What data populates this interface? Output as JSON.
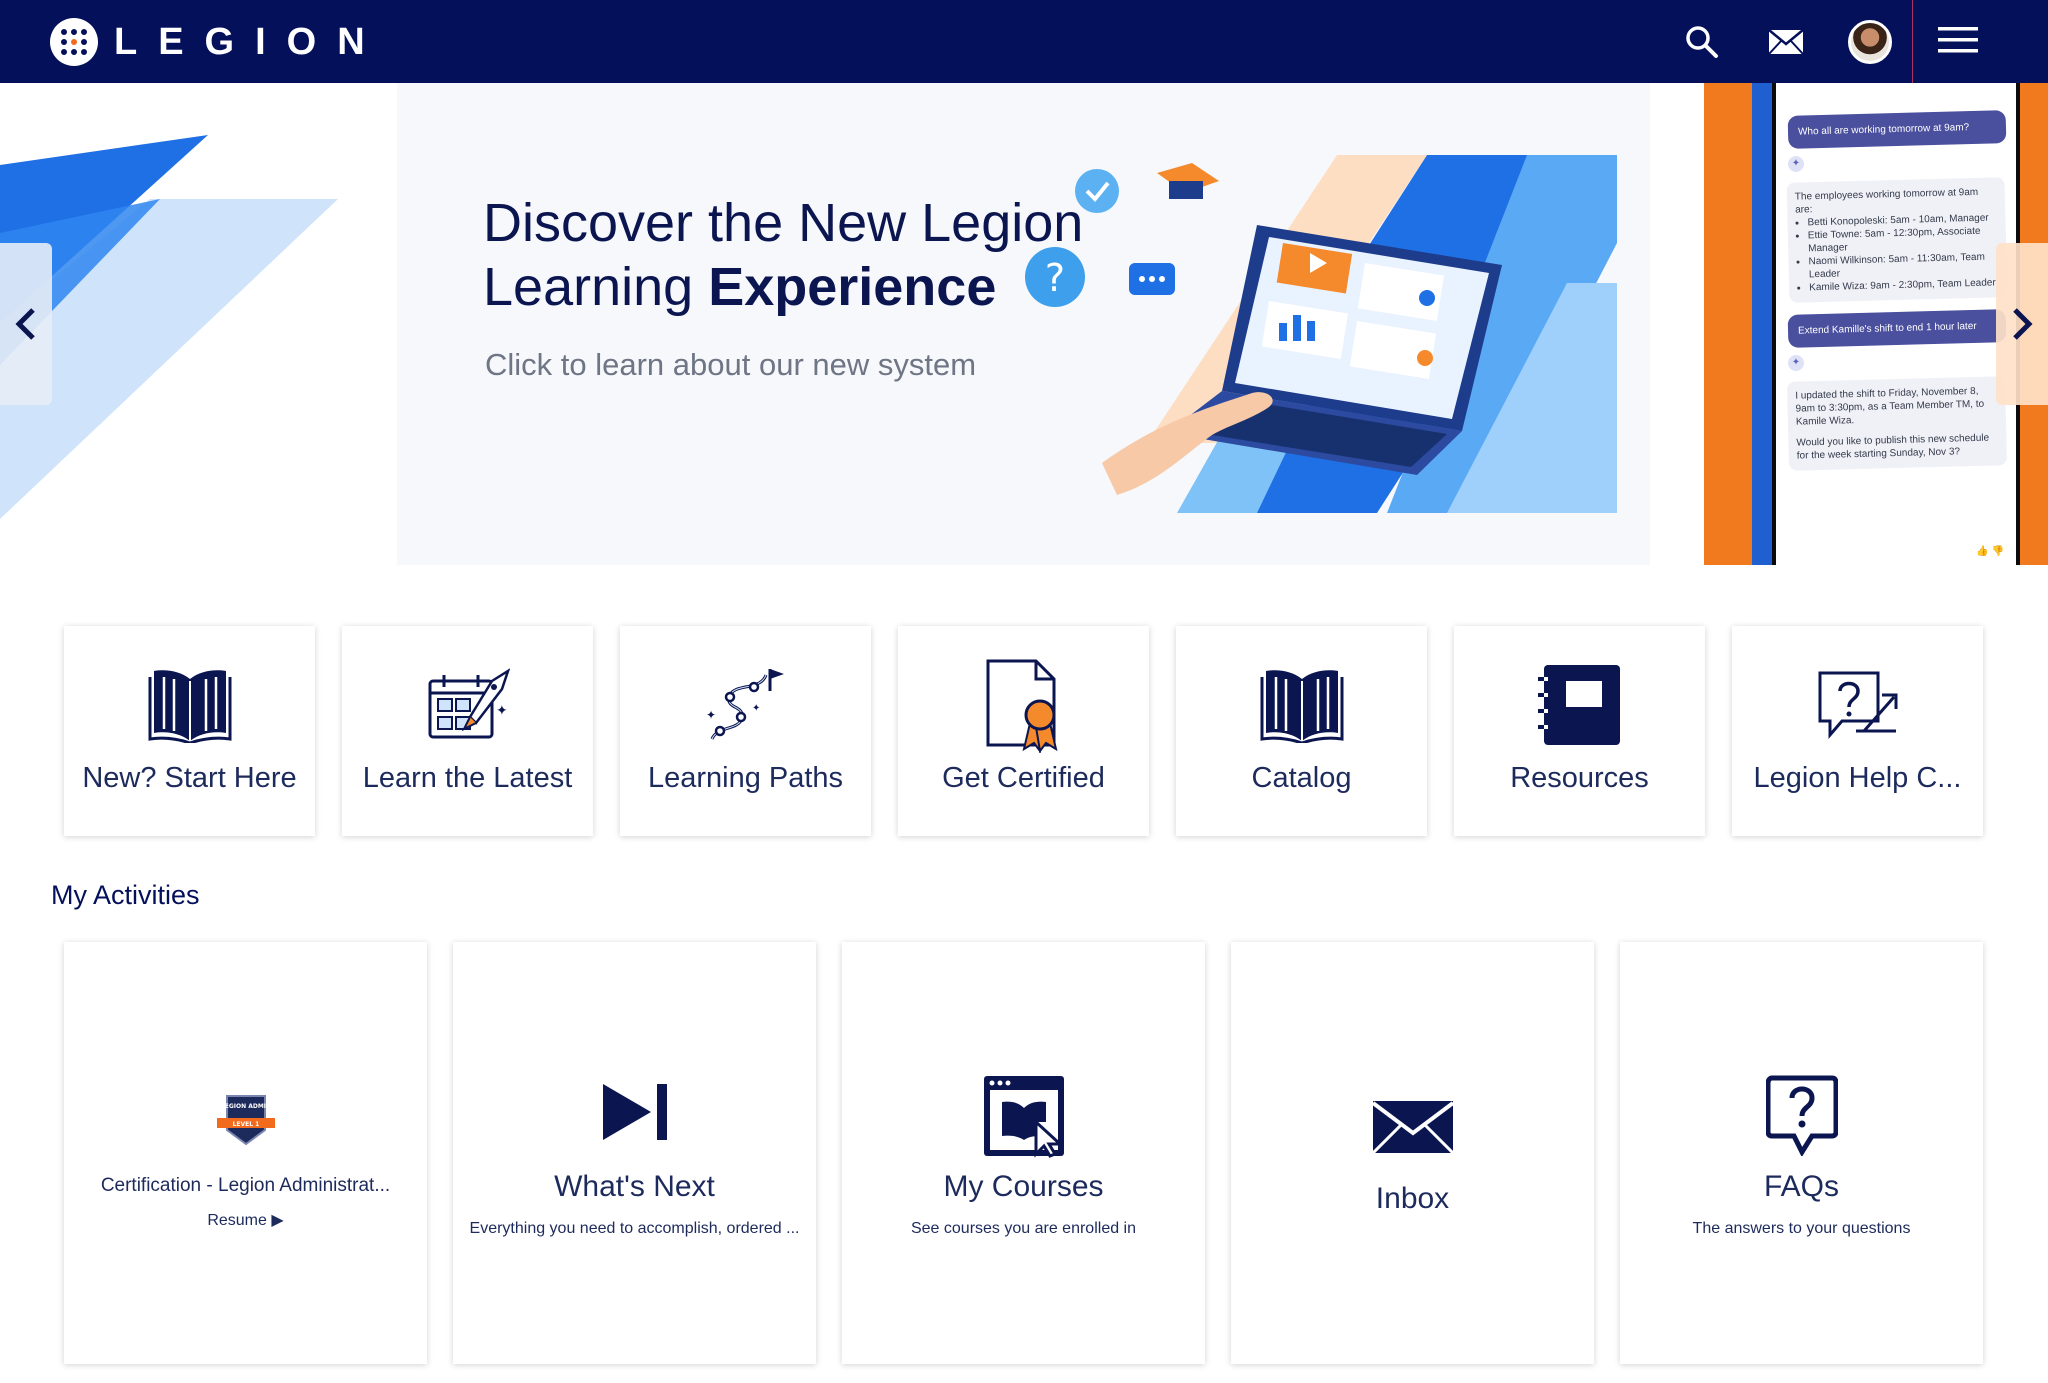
{
  "colors": {
    "navy": "#04105a",
    "accent_orange": "#f26b1d",
    "hero_blue": "#1f6fe5",
    "tile_text": "#1d2a5c"
  },
  "header": {
    "logo_text": "LEGION",
    "icons": [
      "search-icon",
      "mail-icon",
      "avatar",
      "hamburger-menu-icon"
    ]
  },
  "hero": {
    "title_line1": "Discover the New Legion",
    "title_line2_regular": "Learning ",
    "title_line2_bold": "Experience",
    "subtitle": "Click to learn about our new system",
    "next_slide_chat": {
      "question": "Who all are working tomorrow at 9am?",
      "answer_intro": "The employees working tomorrow at 9am are:",
      "answer_items": [
        "Betti Konopoleski: 5am - 10am, Manager",
        "Ettie Towne: 5am - 12:30pm, Associate Manager",
        "Naomi Wilkinson: 5am - 11:30am, Team Leader",
        "Kamile Wiza: 9am - 2:30pm, Team Leader"
      ],
      "request": "Extend Kamille's shift to end 1 hour later",
      "reply_1": "I updated the shift to Friday, November 8, 9am to 3:30pm, as a Team Member TM, to Kamile Wiza.",
      "reply_2": "Would you like to publish this new schedule for the week starting Sunday, Nov 3?"
    }
  },
  "quick_links": [
    {
      "label": "New? Start Here",
      "icon": "open-book-icon"
    },
    {
      "label": "Learn the Latest",
      "icon": "calendar-rocket-icon"
    },
    {
      "label": "Learning Paths",
      "icon": "path-flag-icon"
    },
    {
      "label": "Get Certified",
      "icon": "certificate-icon"
    },
    {
      "label": "Catalog",
      "icon": "open-book-icon"
    },
    {
      "label": "Resources",
      "icon": "notebook-icon"
    },
    {
      "label": "Legion Help C...",
      "icon": "help-chat-icon"
    }
  ],
  "activities": {
    "title": "My Activities",
    "items": [
      {
        "title": "Certification - Legion Administrat...",
        "badge_text": "LEGION ADMIN",
        "badge_level": "LEVEL 1",
        "action": "Resume"
      },
      {
        "title": "What's Next",
        "desc": "Everything you need to accomplish, ordered ..."
      },
      {
        "title": "My Courses",
        "desc": "See courses you are enrolled in"
      },
      {
        "title": "Inbox"
      },
      {
        "title": "FAQs",
        "desc": "The answers to your questions"
      }
    ]
  }
}
